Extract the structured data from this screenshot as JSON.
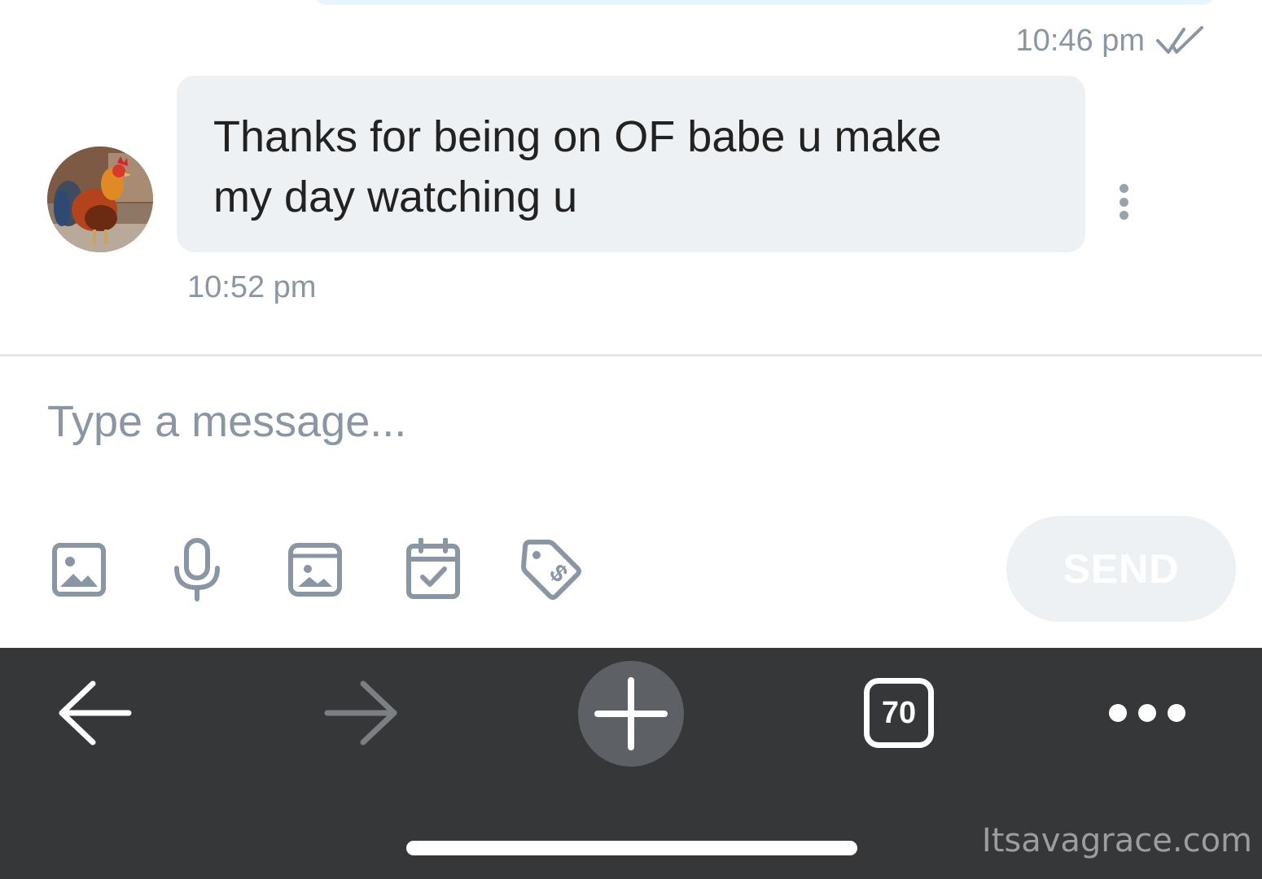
{
  "chat": {
    "sent_time": "10:46 pm",
    "received": {
      "text": "Thanks for being on OF babe u make my day watching u",
      "time": "10:52 pm"
    }
  },
  "composer": {
    "placeholder": "Type a message...",
    "send_label": "SEND",
    "tools": [
      "image-icon",
      "microphone-icon",
      "media-vault-icon",
      "calendar-check-icon",
      "price-tag-icon"
    ]
  },
  "browser_bar": {
    "tabs_count": "70"
  },
  "watermark": "Itsavagrace.com",
  "colors": {
    "bubble_bg": "#eef1f3",
    "muted_text": "#8a96a3",
    "nav_bg": "#353739",
    "plus_bg": "#5d6064"
  }
}
